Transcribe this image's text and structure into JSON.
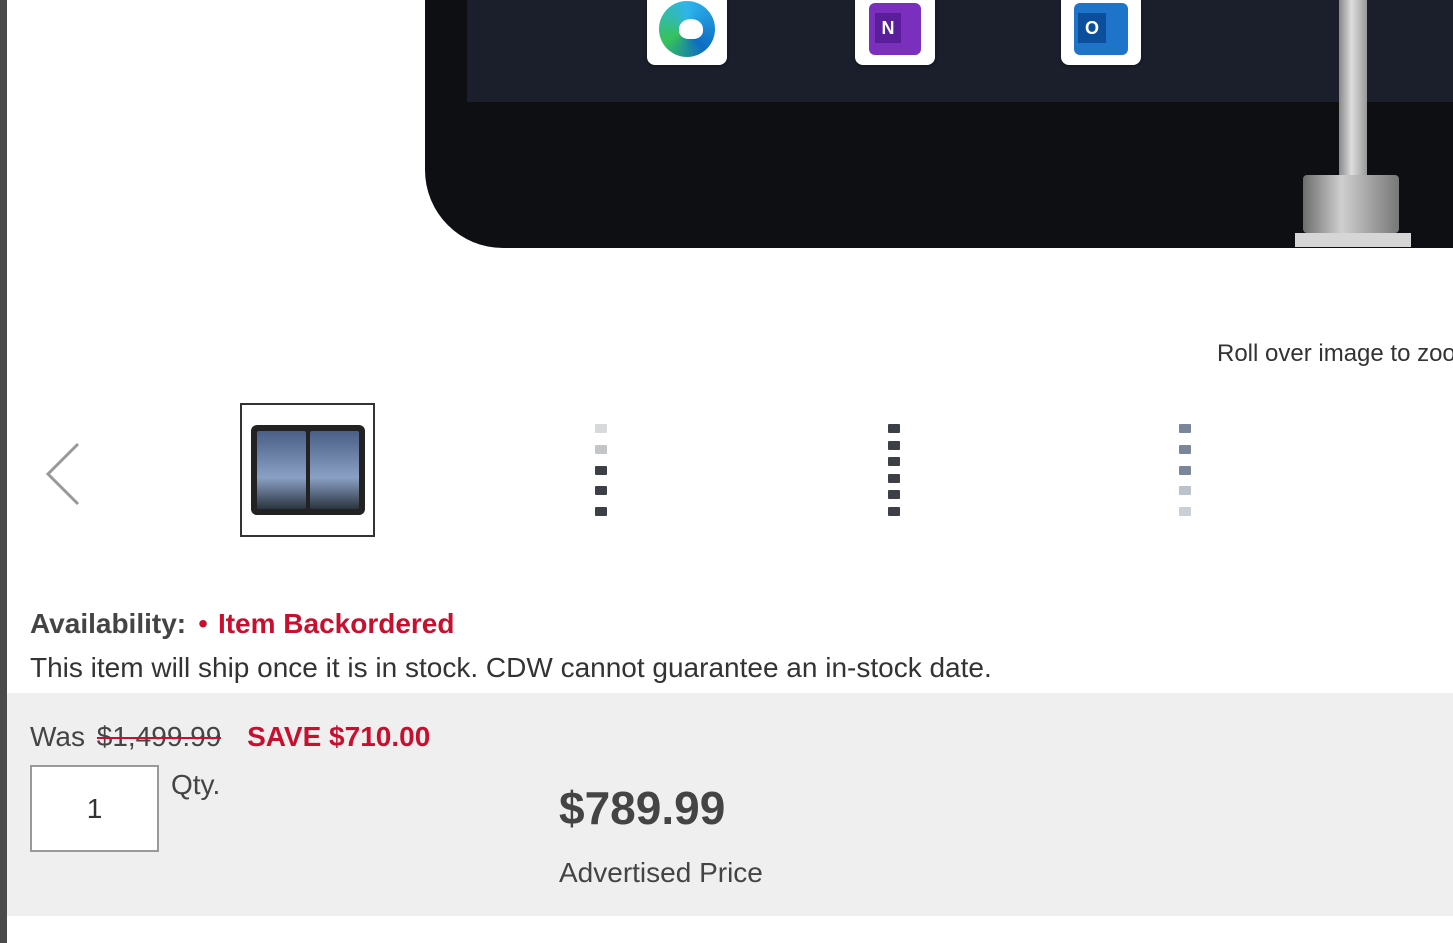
{
  "product_image": {
    "zoom_hint": "Roll over image to zoo",
    "apps": [
      "edge-icon",
      "onenote-icon",
      "outlook-icon"
    ]
  },
  "carousel": {
    "prev_icon": "chevron-left-icon",
    "thumbnails": [
      {
        "name": "thumbnail-front-view",
        "active": true
      },
      {
        "name": "thumbnail-side-view-1",
        "active": false
      },
      {
        "name": "thumbnail-side-view-2",
        "active": false
      },
      {
        "name": "thumbnail-side-view-3",
        "active": false
      }
    ]
  },
  "availability": {
    "label": "Availability:",
    "dot": "•",
    "status": "Item Backordered",
    "note": "This item will ship once it is in stock. CDW cannot guarantee an in-stock date."
  },
  "pricing": {
    "was_label": "Was",
    "was_price": "$1,499.99",
    "save_label": "SAVE $710.00",
    "qty_value": "1",
    "qty_label": "Qty.",
    "price": "$789.99",
    "price_caption": "Advertised Price"
  },
  "colors": {
    "accent_red": "#c8102e",
    "panel_bg": "#efefef"
  }
}
